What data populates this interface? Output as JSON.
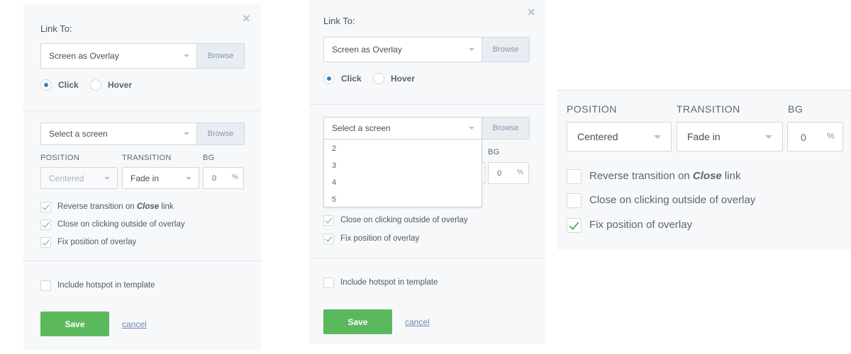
{
  "panel1": {
    "title": "Link To:",
    "close": "×",
    "link_select": "Screen as Overlay",
    "browse": "Browse",
    "radio_click": "Click",
    "radio_hover": "Hover",
    "screen_select": "Select a screen",
    "browse2": "Browse",
    "col_position": "POSITION",
    "col_transition": "TRANSITION",
    "col_bg": "BG",
    "position_value": "Centered",
    "transition_value": "Fade in",
    "bg_value": "0",
    "bg_unit": "%",
    "cb_reverse_pre": "Reverse transition on ",
    "cb_reverse_em": "Close",
    "cb_reverse_post": " link",
    "cb_close_outside": "Close on clicking outside of overlay",
    "cb_fix_position": "Fix position of overlay",
    "cb_include_template": "Include hotspot in template",
    "save": "Save",
    "cancel": "cancel"
  },
  "panel2": {
    "title": "Link To:",
    "close": "×",
    "link_select": "Screen as Overlay",
    "browse": "Browse",
    "radio_click": "Click",
    "radio_hover": "Hover",
    "screen_select": "Select a screen",
    "browse2": "Browse",
    "col_bg": "BG",
    "bg_value": "0",
    "bg_unit": "%",
    "dropdown_options": [
      "2",
      "3",
      "4",
      "5"
    ],
    "cb_close_outside": "Close on clicking outside of overlay",
    "cb_fix_position": "Fix position of overlay",
    "cb_include_template": "Include hotspot in template",
    "save": "Save",
    "cancel": "cancel"
  },
  "zoom": {
    "col_position": "POSITION",
    "col_transition": "TRANSITION",
    "col_bg": "BG",
    "position_value": "Centered",
    "transition_value": "Fade in",
    "bg_value": "0",
    "bg_unit": "%",
    "cb_reverse_pre": "Reverse transition on ",
    "cb_reverse_em": "Close",
    "cb_reverse_post": " link",
    "cb_close_outside": "Close on clicking outside of overlay",
    "cb_fix_position": "Fix position of overlay"
  },
  "colors": {
    "save_green": "#5cb85c",
    "radio_blue": "#3b7fc4",
    "check_green": "#5cae6b",
    "panel_bg": "#f6f8fa"
  }
}
